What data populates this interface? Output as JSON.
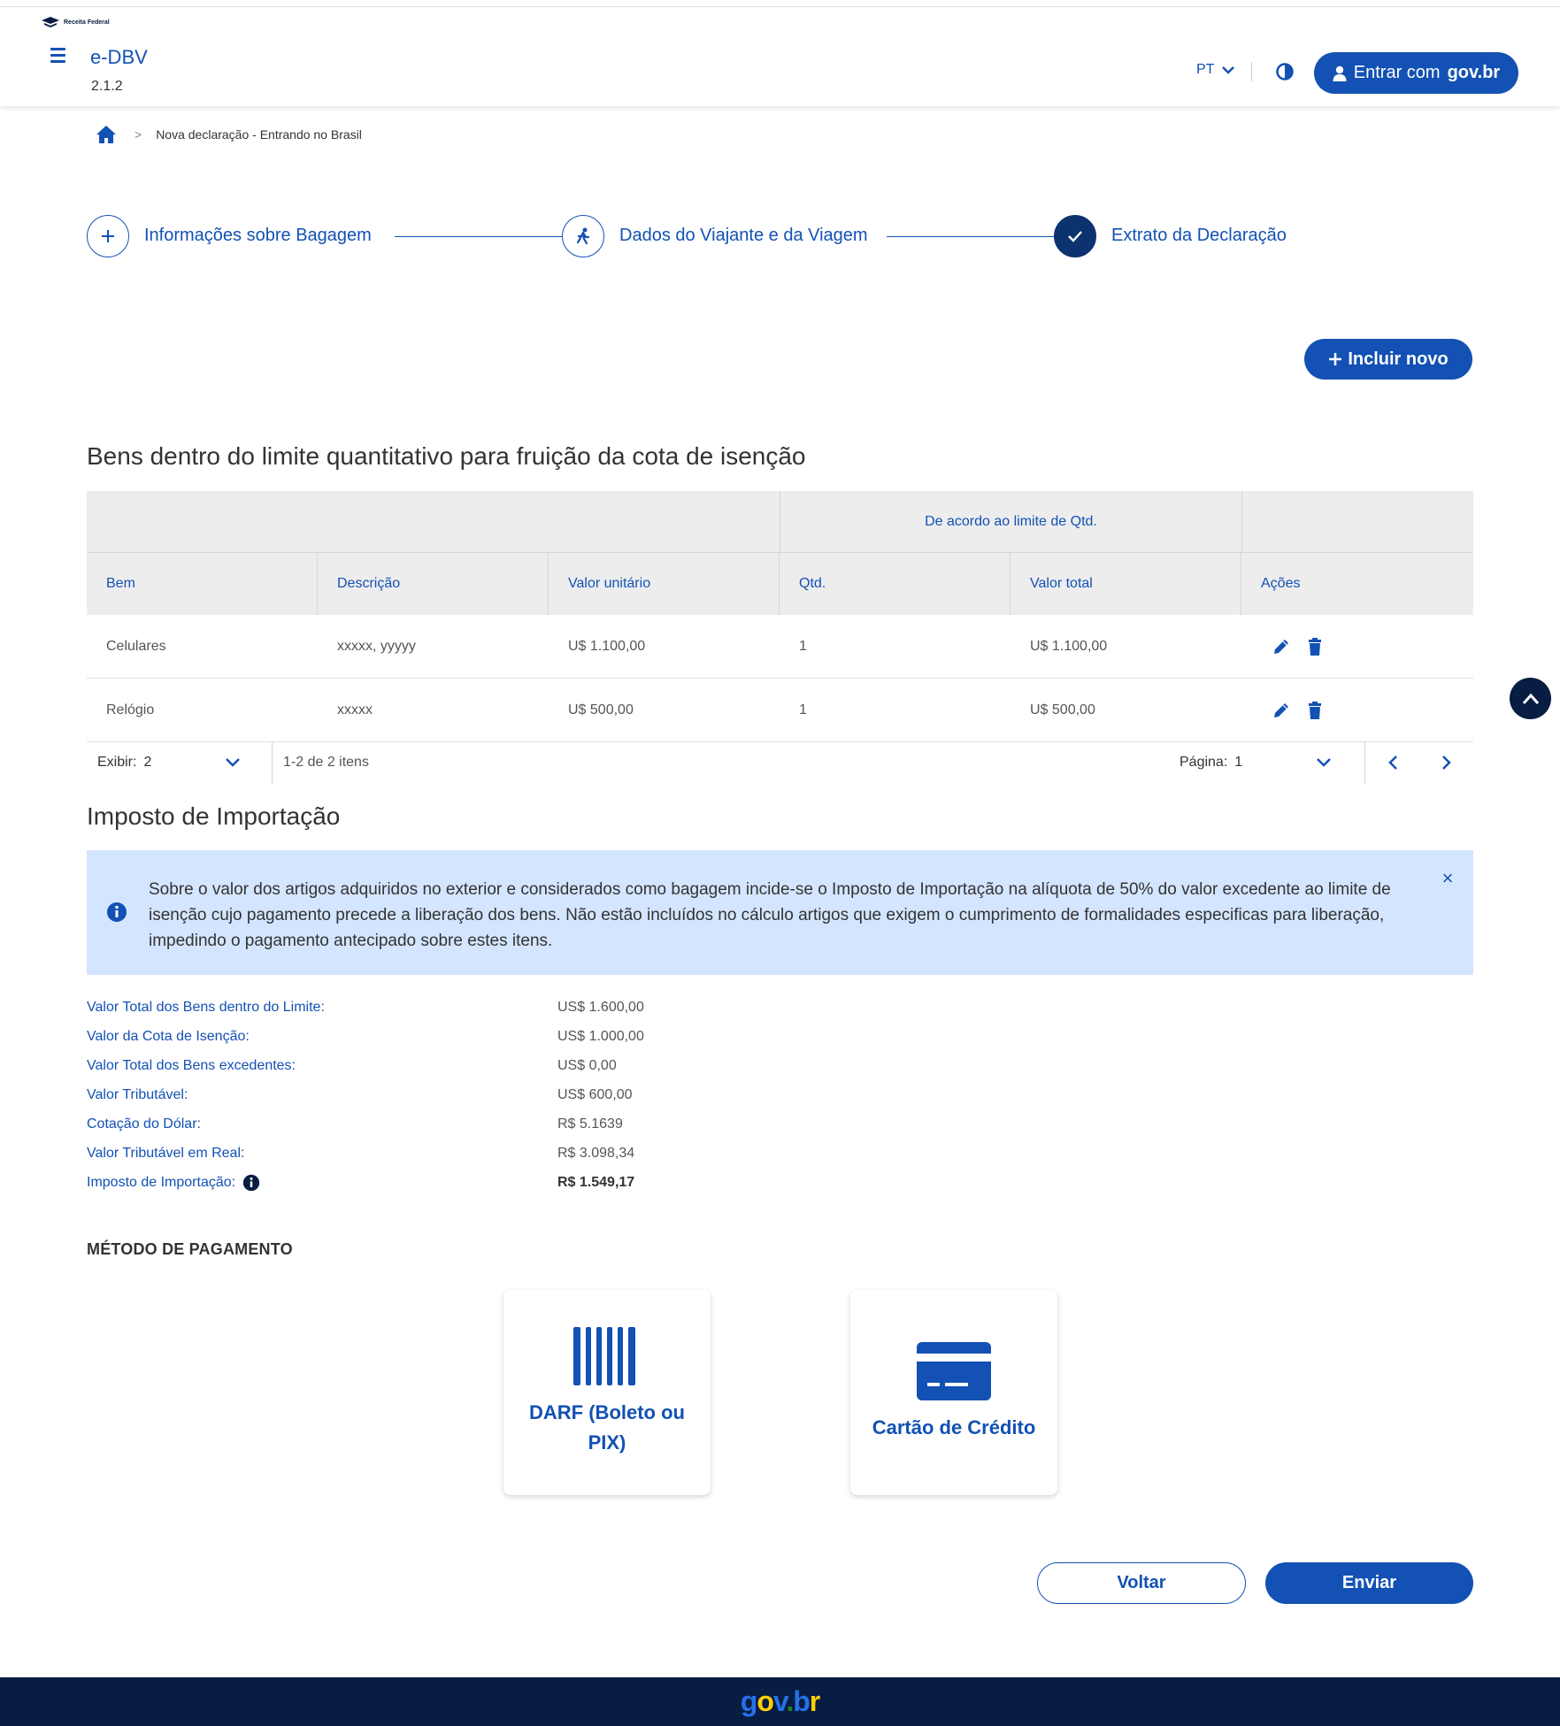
{
  "header": {
    "logo_text": "Receita Federal",
    "app_title": "e-DBV",
    "version": "2.1.2",
    "lang": "PT",
    "login_prefix": "Entrar com",
    "login_brand": "gov.br"
  },
  "breadcrumb": {
    "current": "Nova declaração - Entrando no Brasil"
  },
  "steps": [
    {
      "label": "Informações sobre Bagagem",
      "icon": "plus-icon"
    },
    {
      "label": "Dados do Viajante e da Viagem",
      "icon": "traveler-icon"
    },
    {
      "label": "Extrato da Declaração",
      "icon": "check-icon"
    }
  ],
  "actions": {
    "add_new": "Incluir novo",
    "back": "Voltar",
    "send": "Enviar"
  },
  "table": {
    "title": "Bens dentro do limite quantitativo para fruição da cota de isenção",
    "group_header": "De acordo ao limite de Qtd.",
    "columns": [
      "Bem",
      "Descrição",
      "Valor unitário",
      "Qtd.",
      "Valor total",
      "Ações"
    ],
    "rows": [
      {
        "bem": "Celulares",
        "descricao": "xxxxx, yyyyy",
        "valor_unitario": "U$ 1.100,00",
        "qtd": "1",
        "valor_total": "U$ 1.100,00"
      },
      {
        "bem": "Relógio",
        "descricao": "xxxxx",
        "valor_unitario": "U$ 500,00",
        "qtd": "1",
        "valor_total": "U$ 500,00"
      }
    ],
    "pager": {
      "show_label": "Exibir:",
      "show_value": "2",
      "count_text": "1-2 de 2 itens",
      "page_label": "Página:",
      "page_value": "1"
    }
  },
  "import_tax": {
    "title": "Imposto de Importação",
    "alert": "Sobre o valor dos artigos adquiridos no exterior e considerados como bagagem incide-se o Imposto de Importação na alíquota de 50% do valor excedente ao limite de isenção cujo pagamento precede a liberação dos bens. Não estão incluídos no cálculo artigos que exigem o cumprimento de formalidades especificas para liberação, impedindo o pagamento antecipado sobre estes itens.",
    "summary": [
      {
        "label": "Valor Total dos Bens dentro do Limite:",
        "value": "US$ 1.600,00"
      },
      {
        "label": "Valor da Cota de Isenção:",
        "value": "US$ 1.000,00"
      },
      {
        "label": "Valor Total dos Bens excedentes:",
        "value": "US$ 0,00"
      },
      {
        "label": "Valor Tributável:",
        "value": "US$ 600,00"
      },
      {
        "label": "Cotação do Dólar:",
        "value": "R$ 5.1639"
      },
      {
        "label": "Valor Tributável em Real:",
        "value": "R$ 3.098,34"
      },
      {
        "label": "Imposto de Importação:",
        "value": "R$ 1.549,17"
      }
    ]
  },
  "payment": {
    "title": "MÉTODO DE PAGAMENTO",
    "darf_line1": "DARF (Boleto ou",
    "darf_line2": "PIX)",
    "card": "Cartão de Crédito"
  },
  "footer": {
    "brand_g": "g",
    "brand_o": "o",
    "brand_v": "v",
    "brand_dot": ".",
    "brand_b": "b",
    "brand_r": "r"
  },
  "colors": {
    "primary": "#1351b4",
    "dark": "#071d41",
    "alert_bg": "#d4e5ff"
  }
}
